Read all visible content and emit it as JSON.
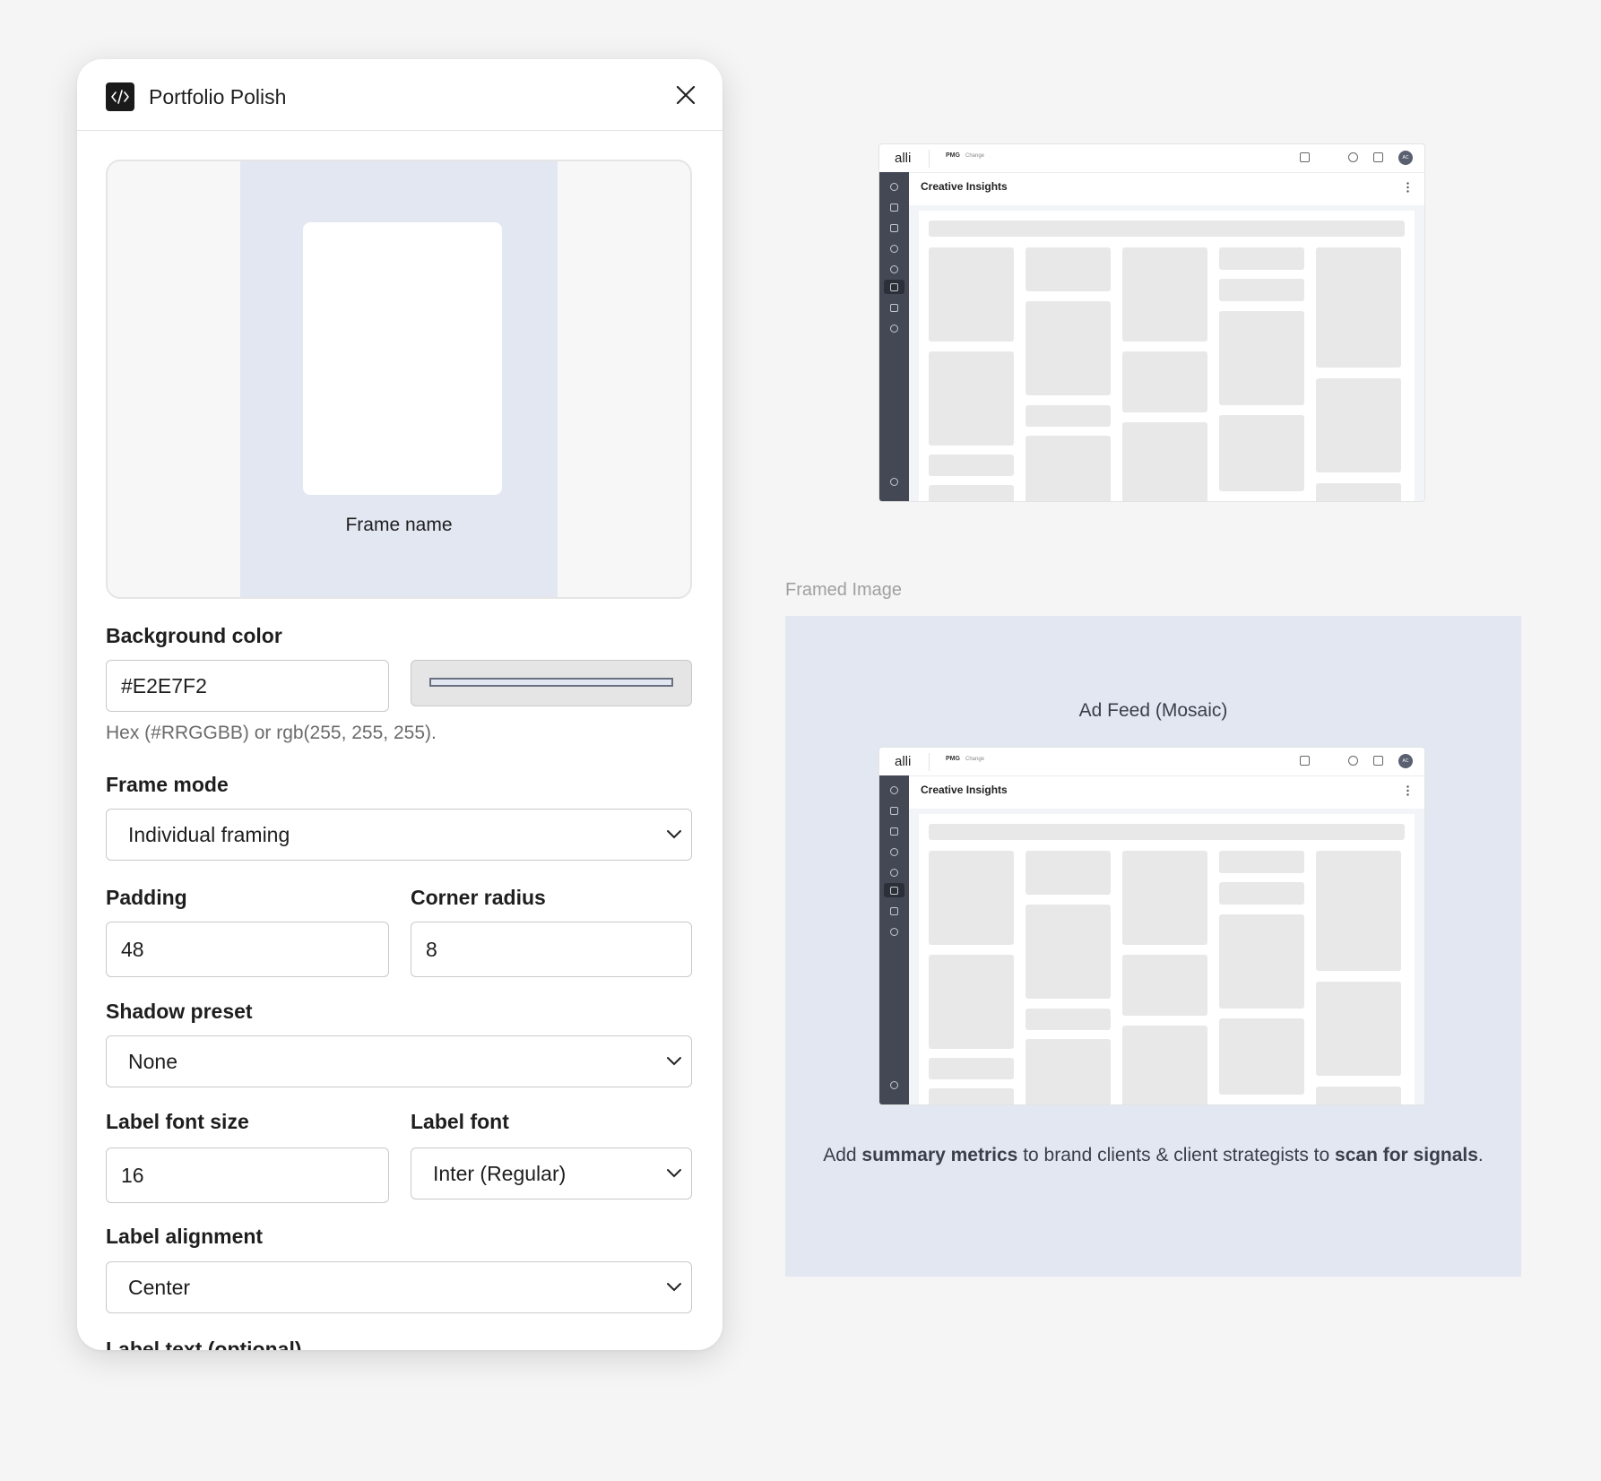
{
  "plugin": {
    "title": "Portfolio Polish",
    "icon": "code-icon",
    "preview": {
      "frame_name": "Frame name",
      "background": "#E2E7F2"
    },
    "fields": {
      "background_color": {
        "label": "Background color",
        "value": "#E2E7F2",
        "help": "Hex (#RRGGBB) or rgb(255, 255, 255)."
      },
      "frame_mode": {
        "label": "Frame mode",
        "value": "Individual framing"
      },
      "padding": {
        "label": "Padding",
        "value": "48"
      },
      "corner_radius": {
        "label": "Corner radius",
        "value": "8"
      },
      "shadow_preset": {
        "label": "Shadow preset",
        "value": "None"
      },
      "label_font_size": {
        "label": "Label font size",
        "value": "16"
      },
      "label_font": {
        "label": "Label font",
        "value": "Inter (Regular)"
      },
      "label_alignment": {
        "label": "Label alignment",
        "value": "Center"
      },
      "label_text": {
        "label": "Label text (optional)"
      }
    }
  },
  "canvas": {
    "framed_caption": "Framed Image",
    "frame_name": "Ad Feed (Mosaic)",
    "summary": {
      "p1": "Add ",
      "b1": "summary metrics",
      "p2": " to brand clients & client strategists to ",
      "b2": "scan for signals",
      "p3": "."
    },
    "app": {
      "logo": "alli",
      "org": "PMG",
      "change": "Change",
      "avatar": "AC",
      "page_title": "Creative Insights"
    }
  },
  "colors": {
    "frame_bg": "#E2E7F2",
    "sidebar": "#434854",
    "placeholder": "#E8E8E8"
  }
}
